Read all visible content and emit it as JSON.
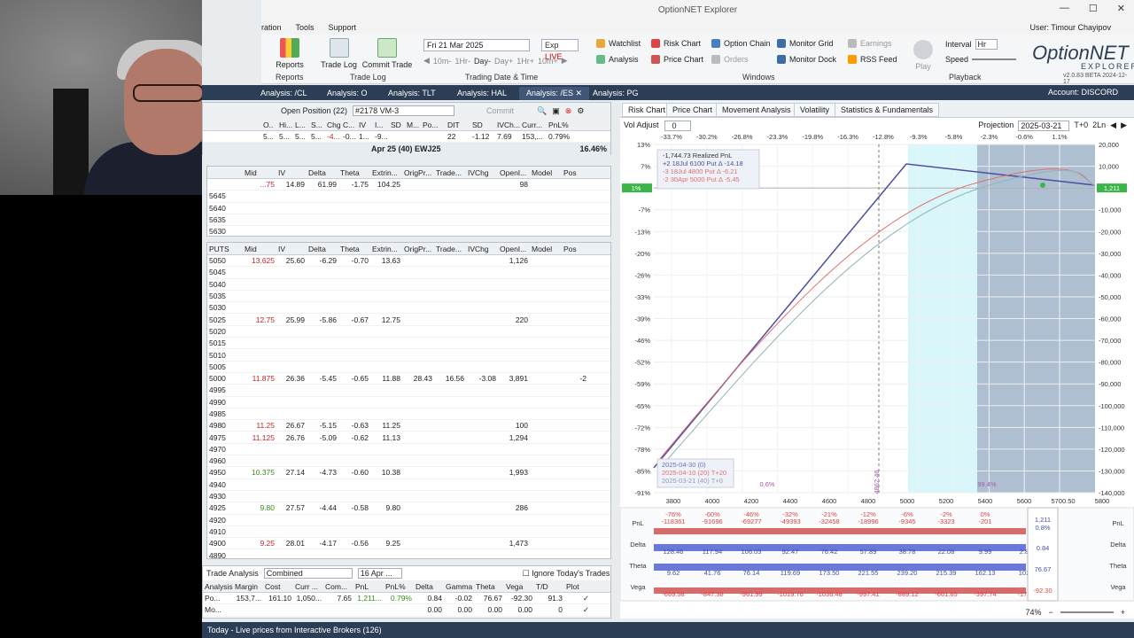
{
  "window": {
    "title": "OptionNET Explorer",
    "user": "User: Timour Chayipov",
    "version": "v2.0.83 BETA 2024-12-17"
  },
  "menu": [
    "ration",
    "Tools",
    "Support"
  ],
  "ribbon": {
    "reports": "Reports",
    "reports_group": "Reports",
    "trade_log": "Trade Log",
    "commit_trade": "Commit Trade",
    "trade_log_group": "Trade Log",
    "date": "Fri 21 Mar 2025",
    "exp": "Exp",
    "live": "LIVE",
    "steps": [
      "10m-",
      "1Hr-",
      "Day-",
      "Day+",
      "1Hr+",
      "10m+"
    ],
    "date_group": "Trading Date & Time",
    "windows": [
      "Watchlist",
      "Risk Chart",
      "Option Chain",
      "Monitor Grid",
      "Earnings",
      "Analysis",
      "Price Chart",
      "Orders",
      "Monitor Dock",
      "RSS Feed"
    ],
    "windows_group": "Windows",
    "play": "Play",
    "interval_label": "Interval",
    "interval_value": "Hr",
    "speed_label": "Speed",
    "playback_group": "Playback"
  },
  "tabs": [
    "Analysis: /CL",
    "Analysis: O",
    "Analysis: TLT",
    "Analysis: HAL",
    "Analysis: /ES",
    "Analysis: PG"
  ],
  "account": "Account: DISCORD",
  "position": {
    "label": "Open Position (22)",
    "selected": "#2178 VM-3",
    "commit": "Commit"
  },
  "pos_header": [
    "O..",
    "Hi...",
    "L...",
    "S...",
    "Chg",
    "C...",
    "IV",
    "I...",
    "SD",
    "M...",
    "Po...",
    "DIT",
    "SD",
    "IVCh...",
    "Curr...",
    "PnL%"
  ],
  "pos_row": [
    "5...",
    "5...",
    "5...",
    "5...",
    "-4...",
    "-0...",
    "1...",
    "-9...",
    "",
    "",
    "",
    "22",
    "-1.12",
    "7.69",
    "153,...",
    "0.79%"
  ],
  "expiry_title": "Apr 25 (40)  EWJ25",
  "expiry_pct": "16.46%",
  "calls_header": [
    "",
    "Mid",
    "IV",
    "Delta",
    "Theta",
    "Extrin...",
    "OrigPr...",
    "Trade...",
    "IVChg",
    "OpenI...",
    "Model",
    "Pos"
  ],
  "calls_rows": [
    [
      "",
      "...75",
      "14.89",
      "61.99",
      "-1.75",
      "104.25",
      "",
      "",
      "",
      "98",
      "",
      ""
    ],
    [
      "5645",
      "",
      "",
      "",
      "",
      "",
      "",
      "",
      "",
      "",
      "",
      ""
    ],
    [
      "5640",
      "",
      "",
      "",
      "",
      "",
      "",
      "",
      "",
      "",
      "",
      ""
    ],
    [
      "5635",
      "",
      "",
      "",
      "",
      "",
      "",
      "",
      "",
      "",
      "",
      ""
    ],
    [
      "5630",
      "",
      "",
      "",
      "",
      "",
      "",
      "",
      "",
      "",
      "",
      ""
    ]
  ],
  "puts_header": [
    "PUTS",
    "Mid",
    "IV",
    "Delta",
    "Theta",
    "Extrin...",
    "OrigPr...",
    "Trade...",
    "IVChg",
    "OpenI...",
    "Model",
    "Pos"
  ],
  "puts_rows": [
    [
      "5050",
      "13.625",
      "25.60",
      "-6.29",
      "-0.70",
      "13.63",
      "",
      "",
      "",
      "1,126",
      "",
      ""
    ],
    [
      "5045",
      "",
      "",
      "",
      "",
      "",
      "",
      "",
      "",
      "",
      "",
      ""
    ],
    [
      "5040",
      "",
      "",
      "",
      "",
      "",
      "",
      "",
      "",
      "",
      "",
      ""
    ],
    [
      "5035",
      "",
      "",
      "",
      "",
      "",
      "",
      "",
      "",
      "",
      "",
      ""
    ],
    [
      "5030",
      "",
      "",
      "",
      "",
      "",
      "",
      "",
      "",
      "",
      "",
      ""
    ],
    [
      "5025",
      "12.75",
      "25.99",
      "-5.86",
      "-0.67",
      "12.75",
      "",
      "",
      "",
      "220",
      "",
      ""
    ],
    [
      "5020",
      "",
      "",
      "",
      "",
      "",
      "",
      "",
      "",
      "",
      "",
      ""
    ],
    [
      "5015",
      "",
      "",
      "",
      "",
      "",
      "",
      "",
      "",
      "",
      "",
      ""
    ],
    [
      "5010",
      "",
      "",
      "",
      "",
      "",
      "",
      "",
      "",
      "",
      "",
      ""
    ],
    [
      "5005",
      "",
      "",
      "",
      "",
      "",
      "",
      "",
      "",
      "",
      "",
      ""
    ],
    [
      "5000",
      "11.875",
      "26.36",
      "-5.45",
      "-0.65",
      "11.88",
      "28.43",
      "16.56",
      "-3.08",
      "3,891",
      "",
      "-2"
    ],
    [
      "4995",
      "",
      "",
      "",
      "",
      "",
      "",
      "",
      "",
      "",
      "",
      ""
    ],
    [
      "4990",
      "",
      "",
      "",
      "",
      "",
      "",
      "",
      "",
      "",
      "",
      ""
    ],
    [
      "4985",
      "",
      "",
      "",
      "",
      "",
      "",
      "",
      "",
      "",
      "",
      ""
    ],
    [
      "4980",
      "11.25",
      "26.67",
      "-5.15",
      "-0.63",
      "11.25",
      "",
      "",
      "",
      "100",
      "",
      ""
    ],
    [
      "4975",
      "11.125",
      "26.76",
      "-5.09",
      "-0.62",
      "11.13",
      "",
      "",
      "",
      "1,294",
      "",
      ""
    ],
    [
      "4970",
      "",
      "",
      "",
      "",
      "",
      "",
      "",
      "",
      "",
      "",
      ""
    ],
    [
      "4960",
      "",
      "",
      "",
      "",
      "",
      "",
      "",
      "",
      "",
      "",
      ""
    ],
    [
      "4950",
      "10.375",
      "27.14",
      "-4.73",
      "-0.60",
      "10.38",
      "",
      "",
      "",
      "1,993",
      "",
      ""
    ],
    [
      "4940",
      "",
      "",
      "",
      "",
      "",
      "",
      "",
      "",
      "",
      "",
      ""
    ],
    [
      "4930",
      "",
      "",
      "",
      "",
      "",
      "",
      "",
      "",
      "",
      "",
      ""
    ],
    [
      "4925",
      "9.80",
      "27.57",
      "-4.44",
      "-0.58",
      "9.80",
      "",
      "",
      "",
      "286",
      "",
      ""
    ],
    [
      "4920",
      "",
      "",
      "",
      "",
      "",
      "",
      "",
      "",
      "",
      "",
      ""
    ],
    [
      "4910",
      "",
      "",
      "",
      "",
      "",
      "",
      "",
      "",
      "",
      "",
      ""
    ],
    [
      "4900",
      "9.25",
      "28.01",
      "-4.17",
      "-0.56",
      "9.25",
      "",
      "",
      "",
      "1,473",
      "",
      ""
    ],
    [
      "4890",
      "",
      "",
      "",
      "",
      "",
      "",
      "",
      "",
      "",
      "",
      ""
    ]
  ],
  "trade_analysis": {
    "label": "Trade Analysis",
    "mode": "Combined",
    "date": "16 Apr ...",
    "ignore": "Ignore Today's Trades"
  },
  "ta_header": [
    "Analysis",
    "Margin",
    "Cost",
    "Curr ...",
    "Com...",
    "PnL",
    "PnL%",
    "Delta",
    "Gamma",
    "Theta",
    "Vega",
    "T/D",
    "Plot"
  ],
  "ta_rows": [
    [
      "Po...",
      "153,7...",
      "161.10",
      "1,050...",
      "7.65",
      "1,211...",
      "0.79%",
      "0.84",
      "-0.02",
      "76.67",
      "-92.30",
      "91.3",
      "✓"
    ],
    [
      "Mo...",
      "",
      "",
      "",
      "",
      "",
      "",
      "0.00",
      "0.00",
      "0.00",
      "0.00",
      "0",
      "✓"
    ]
  ],
  "chart_tabs": [
    "Risk Chart",
    "Price Chart",
    "Movement Analysis",
    "Volatility",
    "Statistics & Fundamentals"
  ],
  "vol_adjust_label": "Vol Adjust",
  "vol_adjust_value": "0",
  "projection_label": "Projection",
  "projection_value": "2025-03-21",
  "projection_t": "T+0",
  "projection_ln": "2Ln",
  "legend": [
    "-1,744.73 Realized PnL",
    "+2 18Jul 6100 Put Δ  -14.18",
    "-3 18Jul 4800 Put Δ  -6.21",
    "-2 30Apr 5000 Put Δ  -5.45"
  ],
  "date_legend": [
    "2025-04-30 (0)",
    "2025-04-10 (20) T+20",
    "2025-03-21 (40) T+0"
  ],
  "top_pct_labels": [
    "-33.7%",
    "-30.2%",
    "-26.8%",
    "-23.3%",
    "-19.8%",
    "-16.3%",
    "-12.8%",
    "-9.3%",
    "-5.8%",
    "-2.3%",
    "-0.6%",
    "1.1%"
  ],
  "left_pct_labels": [
    "13%",
    "7%",
    "1%",
    "-7%",
    "-13%",
    "-20%",
    "-26%",
    "-33%",
    "-39%",
    "-46%",
    "-52%",
    "-59%",
    "-65%",
    "-72%",
    "-78%",
    "-85%",
    "-91%"
  ],
  "right_pnl_labels": [
    "20,000",
    "10,000",
    "1,211",
    "-10,000",
    "-20,000",
    "-30,000",
    "-40,000",
    "-50,000",
    "-60,000",
    "-70,000",
    "-80,000",
    "-90,000",
    "-100,000",
    "-110,000",
    "-120,000",
    "-130,000",
    "-140,000"
  ],
  "bottom_x_labels": [
    "3800",
    "4000",
    "4200",
    "4400",
    "4600",
    "4800",
    "5000",
    "5200",
    "5400",
    "5600",
    "5700.50",
    "5800"
  ],
  "marker_left_pct": "0.6%",
  "marker_right_pct": "99.4%",
  "marker_vline_label": "4862.46",
  "greek_labels": [
    "PnL",
    "Delta",
    "Theta",
    "Vega"
  ],
  "greek_values": {
    "pnl": "1,211",
    "pnl_pct": "0.8%",
    "delta": "0.84",
    "theta": "76.67",
    "vega": "-92.30"
  },
  "pnl_row_pct": [
    "-76%",
    "-60%",
    "-46%",
    "-32%",
    "-21%",
    "-12%",
    "-6%",
    "-2%",
    "0%"
  ],
  "pnl_row_vals": [
    "-118361",
    "-91696",
    "-69277",
    "-49393",
    "-32458",
    "-18996",
    "-9345",
    "-3323",
    "-201"
  ],
  "delta_row": [
    "128.46",
    "117.94",
    "106.03",
    "92.47",
    "76.42",
    "57.89",
    "38.78",
    "22.08",
    "9.99",
    "2.8"
  ],
  "theta_row": [
    "9.62",
    "41.76",
    "76.14",
    "119.69",
    "173.50",
    "221.55",
    "239.20",
    "215.39",
    "162.13",
    "102"
  ],
  "vega_row": [
    "-669.58",
    "-847.38",
    "-961.99",
    "-1019.76",
    "-1036.48",
    "-997.41",
    "-889.12",
    "-661.65",
    "-397.74",
    "-176"
  ],
  "zoom": "74%",
  "status": "Today - Live prices from Interactive Brokers (126)",
  "colors": {
    "accent": "#2b3e55",
    "tab": "#3f5676",
    "curve_t0": "#4b4f9e",
    "curve_red": "#e07070",
    "band_cyan": "#d9f7fb",
    "band_blue": "#aebfd2"
  }
}
